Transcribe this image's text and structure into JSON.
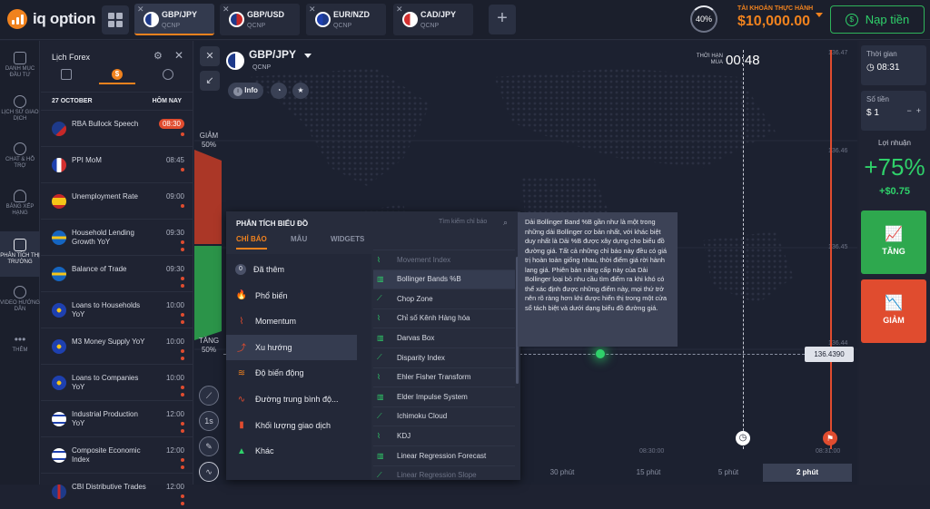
{
  "app": {
    "logo_text": "iq option"
  },
  "tabs": [
    {
      "pair": "GBP/JPY",
      "sub": "QCNP",
      "active": true
    },
    {
      "pair": "GBP/USD",
      "sub": "QCNP",
      "active": false
    },
    {
      "pair": "EUR/NZD",
      "sub": "QCNP",
      "active": false
    },
    {
      "pair": "CAD/JPY",
      "sub": "QCNP",
      "active": false
    }
  ],
  "account": {
    "percent": "40%",
    "label": "TÀI KHOẢN THỰC HÀNH",
    "balance": "$10,000.00",
    "deposit_label": "Nạp tiền"
  },
  "nav": [
    {
      "label": "DANH MỤC ĐẦU TƯ",
      "icon": "briefcase-icon"
    },
    {
      "label": "LỊCH SỬ GIAO DỊCH",
      "icon": "history-icon"
    },
    {
      "label": "CHAT & HỖ TRỢ",
      "icon": "chat-icon"
    },
    {
      "label": "BẢNG XẾP HẠNG",
      "icon": "trophy-icon"
    },
    {
      "label": "PHÂN TÍCH THỊ TRƯỜNG",
      "icon": "news-icon"
    },
    {
      "label": "VIDEO HƯỚNG DẪN",
      "icon": "play-icon"
    },
    {
      "label": "THÊM",
      "icon": "more-icon"
    }
  ],
  "forex": {
    "title": "Lịch Forex",
    "date": "27 OCTOBER",
    "today": "HÔM NAY",
    "events": [
      {
        "name": "RBA Bullock Speech",
        "time": "08:30",
        "hot": true,
        "flag": "au"
      },
      {
        "name": "PPI MoM",
        "time": "08:45",
        "hot": false,
        "flag": "fr"
      },
      {
        "name": "Unemployment Rate",
        "time": "09:00",
        "hot": false,
        "flag": "es"
      },
      {
        "name": "Household Lending Growth YoY",
        "time": "09:30",
        "hot": false,
        "flag": "se"
      },
      {
        "name": "Balance of Trade",
        "time": "09:30",
        "hot": false,
        "flag": "se"
      },
      {
        "name": "Loans to Households YoY",
        "time": "10:00",
        "hot": false,
        "flag": "eu"
      },
      {
        "name": "M3 Money Supply YoY",
        "time": "10:00",
        "hot": false,
        "flag": "eu"
      },
      {
        "name": "Loans to Companies YoY",
        "time": "10:00",
        "hot": false,
        "flag": "eu"
      },
      {
        "name": "Industrial Production YoY",
        "time": "12:00",
        "hot": false,
        "flag": "il"
      },
      {
        "name": "Composite Economic Index",
        "time": "12:00",
        "hot": false,
        "flag": "il"
      },
      {
        "name": "CBI Distributive Trades",
        "time": "12:00",
        "hot": false,
        "flag": "gb"
      }
    ]
  },
  "chart": {
    "pair": "GBP/JPY",
    "sub": "QCNP",
    "info_label": "Info",
    "timer_label": "THỜI HẠN MUA",
    "timer": "00:48",
    "down_label": "GIẢM",
    "down_pct": "50%",
    "up_label": "TĂNG",
    "up_pct": "50%",
    "price": "136.4390",
    "y_ticks": [
      "136.47",
      "136.46",
      "136.45",
      "136.44"
    ],
    "x_ticks": [
      "08:30:00",
      "08:31:00"
    ],
    "timeframes": [
      "30 phút",
      "15 phút",
      "5 phút",
      "2 phút"
    ],
    "candle_size": "1s"
  },
  "panel": {
    "title": "PHÂN TÍCH BIỂU ĐỒ",
    "search_placeholder": "Tìm kiếm chỉ báo",
    "tabs": [
      "CHỈ BÁO",
      "MẪU",
      "WIDGETS"
    ],
    "categories": [
      {
        "label": "Đã thêm",
        "badge": "0"
      },
      {
        "label": "Phổ biến"
      },
      {
        "label": "Momentum"
      },
      {
        "label": "Xu hướng",
        "active": true
      },
      {
        "label": "Độ biến động"
      },
      {
        "label": "Đường trung bình độ..."
      },
      {
        "label": "Khối lượng giao dịch"
      },
      {
        "label": "Khác"
      }
    ],
    "indicators": [
      "Movement Index",
      "Bollinger Bands %B",
      "Chop Zone",
      "Chỉ số Kênh Hàng hóa",
      "Darvas Box",
      "Disparity Index",
      "Ehler Fisher Transform",
      "Elder Impulse System",
      "Ichimoku Cloud",
      "KDJ",
      "Linear Regression Forecast",
      "Linear Regression Slope"
    ],
    "tooltip": "Dải Bollinger Band %B gần như là một trong những dải Bollinger cơ bản nhất, với khác biệt duy nhất là Dải %B được xây dựng cho biểu đồ đường giá. Tất cả những chỉ báo này đều có giá trị hoàn toàn giống nhau, thời điểm giá rời hành lang giá. Phiên bản nâng cấp này của Dải Bollinger loại bỏ nhu cầu tìm điểm ra khi khó có thể xác định được những điểm này, mọi thứ trở nên rõ ràng hơn khi được hiển thị trong một cửa sổ tách biệt và dưới dạng biểu đồ đường giá."
  },
  "trade": {
    "time_label": "Thời gian",
    "time_value": "08:31",
    "amount_label": "Số tiền",
    "amount_value": "$ 1",
    "profit_label": "Lợi nhuận",
    "profit_pct": "+75%",
    "profit_amt": "+$0.75",
    "up_label": "TĂNG",
    "down_label": "GIẢM"
  },
  "colors": {
    "accent": "#f0821e",
    "up": "#2ea84e",
    "down": "#e04c2f"
  }
}
